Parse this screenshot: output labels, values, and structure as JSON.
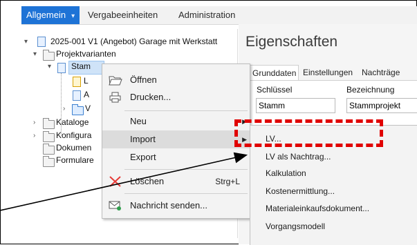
{
  "topmenu": {
    "items": [
      "Allgemein",
      "Vergabeeinheiten",
      "Administration"
    ],
    "active_caret": "▾"
  },
  "tree": {
    "root": "2025-001 V1 (Angebot) Garage mit Werkstatt",
    "projektvarianten": "Projektvarianten",
    "stamm_partial": "Stam",
    "l_partial": "L",
    "a_partial": "A",
    "v_partial": "V",
    "kataloge_partial": "Kataloge",
    "konfigura_partial": "Konfigura",
    "dokumen_partial": "Dokumen",
    "formulare_partial": "Formulare"
  },
  "properties": {
    "title": "Eigenschaften",
    "tabs": [
      "Grunddaten",
      "Einstellungen",
      "Nachträge"
    ],
    "schluessel_label": "Schlüssel",
    "schluessel_value": "Stamm",
    "bezeichnung_label": "Bezeichnung",
    "bezeichnung_value": "Stammprojekt"
  },
  "context_menu": {
    "oeffnen": "Öffnen",
    "drucken": "Drucken...",
    "neu": "Neu",
    "import": "Import",
    "export": "Export",
    "loeschen": "Löschen",
    "loeschen_shortcut": "Strg+L",
    "nachricht": "Nachricht senden..."
  },
  "import_submenu": [
    "LV...",
    "LV als Nachtrag...",
    "Kalkulation",
    "Kostenermittlung...",
    "Materialeinkaufsdokument...",
    "Vorgangsmodell"
  ],
  "colors": {
    "accent": "#1e73d6",
    "highlight": "#e00000"
  }
}
